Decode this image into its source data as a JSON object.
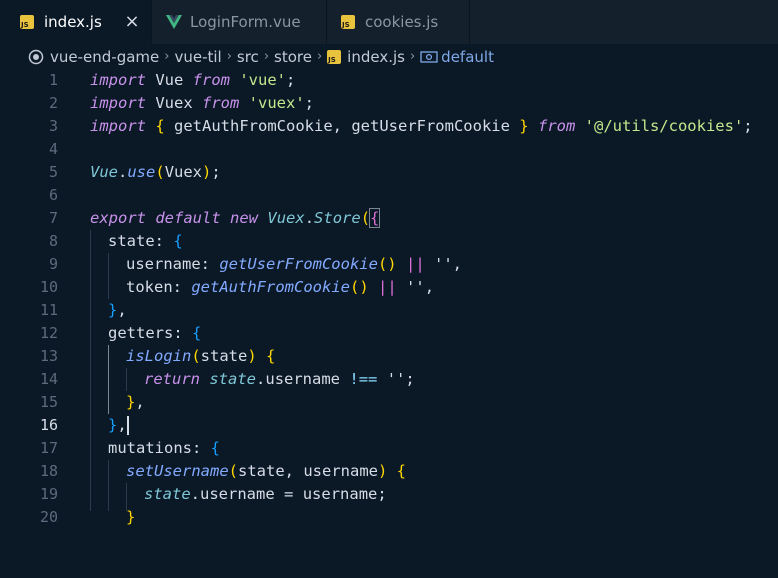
{
  "tabs": [
    {
      "label": "index.js",
      "icon": "js-icon",
      "active": true,
      "close": "×"
    },
    {
      "label": "LoginForm.vue",
      "icon": "vue-icon",
      "active": false
    },
    {
      "label": "cookies.js",
      "icon": "js-icon",
      "active": false
    }
  ],
  "breadcrumb": {
    "items": [
      "vue-end-game",
      "vue-til",
      "src",
      "store",
      "index.js",
      "default"
    ],
    "separator": "›"
  },
  "editor": {
    "current_line": 16,
    "line_numbers": [
      "1",
      "2",
      "3",
      "4",
      "5",
      "6",
      "7",
      "8",
      "9",
      "10",
      "11",
      "12",
      "13",
      "14",
      "15",
      "16",
      "17",
      "18",
      "19",
      "20"
    ]
  },
  "colors": {
    "background": "#0b1826",
    "tabbar": "#15202d",
    "keyword": "#c792ea",
    "function": "#82aaff",
    "string": "#c3e88d",
    "bracket_gold": "#ffd700"
  },
  "code": {
    "l1": [
      "import",
      " Vue ",
      "from",
      " ",
      "'vue'",
      ";"
    ],
    "l2": [
      "import",
      " Vuex ",
      "from",
      " ",
      "'vuex'",
      ";"
    ],
    "l3": [
      "import",
      " ",
      "{",
      " getAuthFromCookie, getUserFromCookie ",
      "}",
      " ",
      "from",
      " ",
      "'@/utils/cookies'",
      ";"
    ],
    "l5": [
      "Vue",
      ".",
      "use",
      "(",
      "Vuex",
      ")",
      ";"
    ],
    "l7": [
      "export",
      " ",
      "default",
      " ",
      "new",
      " ",
      "Vuex",
      ".",
      "Store",
      "(",
      "{"
    ],
    "l8": [
      "state",
      ": ",
      "{"
    ],
    "l9": [
      "username",
      ": ",
      "getUserFromCookie",
      "()",
      " ",
      "||",
      " ",
      "''",
      ","
    ],
    "l10": [
      "token",
      ": ",
      "getAuthFromCookie",
      "()",
      " ",
      "||",
      " ",
      "''",
      ","
    ],
    "l11": [
      "}",
      ","
    ],
    "l12": [
      "getters",
      ": ",
      "{"
    ],
    "l13": [
      "isLogin",
      "(",
      "state",
      ")",
      " ",
      "{"
    ],
    "l14": [
      "return",
      " ",
      "state",
      ".",
      "username",
      " ",
      "!==",
      " ",
      "''",
      ";"
    ],
    "l15": [
      "}",
      ","
    ],
    "l16": [
      "}",
      ","
    ],
    "l17": [
      "mutations",
      ": ",
      "{"
    ],
    "l18": [
      "setUsername",
      "(",
      "state, username",
      ")",
      " ",
      "{"
    ],
    "l19": [
      "state",
      ".",
      "username",
      " ",
      "=",
      " ",
      "username",
      ";"
    ],
    "l20": [
      "}"
    ]
  }
}
